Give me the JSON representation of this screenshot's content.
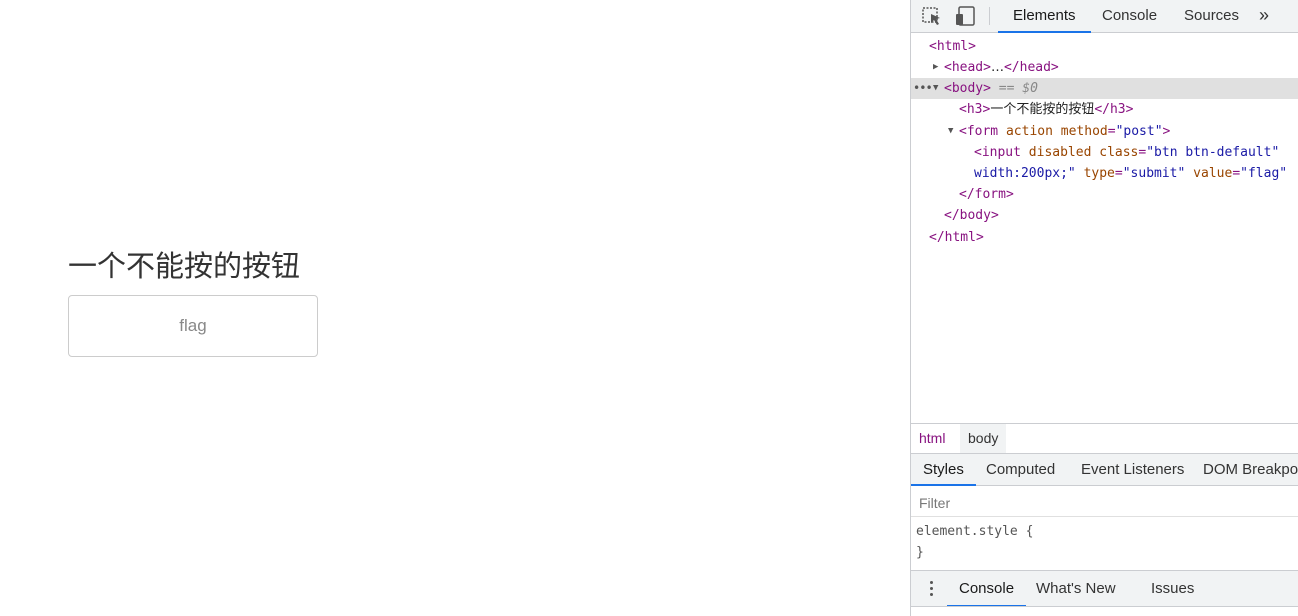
{
  "page": {
    "heading": "一个不能按的按钮",
    "button_value": "flag"
  },
  "devtools": {
    "tabs": [
      "Elements",
      "Console",
      "Sources"
    ],
    "more_label": "»",
    "tree": {
      "html_open": "<html>",
      "head_tag": "<head>",
      "head_ellipsis": "…",
      "head_close": "</head>",
      "body_tag": "<body>",
      "body_eq": "== $0",
      "h3_open": "<h3>",
      "h3_text": "一个不能按的按钮",
      "h3_close": "</h3>",
      "form_open_tag": "<form",
      "form_attr1": "action",
      "form_attr2": "method",
      "form_attr2_val": "\"post\"",
      "form_open_end": ">",
      "input_tag": "<input",
      "input_attr1": "disabled",
      "input_attr2": "class",
      "input_attr2_val": "\"btn btn-default\"",
      "input_line2_val": "width:200px;\"",
      "input_attr3": "type",
      "input_attr3_val": "\"submit\"",
      "input_attr4": "value",
      "input_attr4_val": "\"flag\"",
      "form_close": "</form>",
      "body_close": "</body>",
      "html_close": "</html>"
    },
    "breadcrumbs": [
      "html",
      "body"
    ],
    "style_tabs": [
      "Styles",
      "Computed",
      "Event Listeners",
      "DOM Breakpoints"
    ],
    "filter_placeholder": "Filter",
    "style_rule_line1": "element.style {",
    "style_rule_line2": "}",
    "drawer_tabs": [
      "Console",
      "What's New",
      "Issues"
    ]
  }
}
